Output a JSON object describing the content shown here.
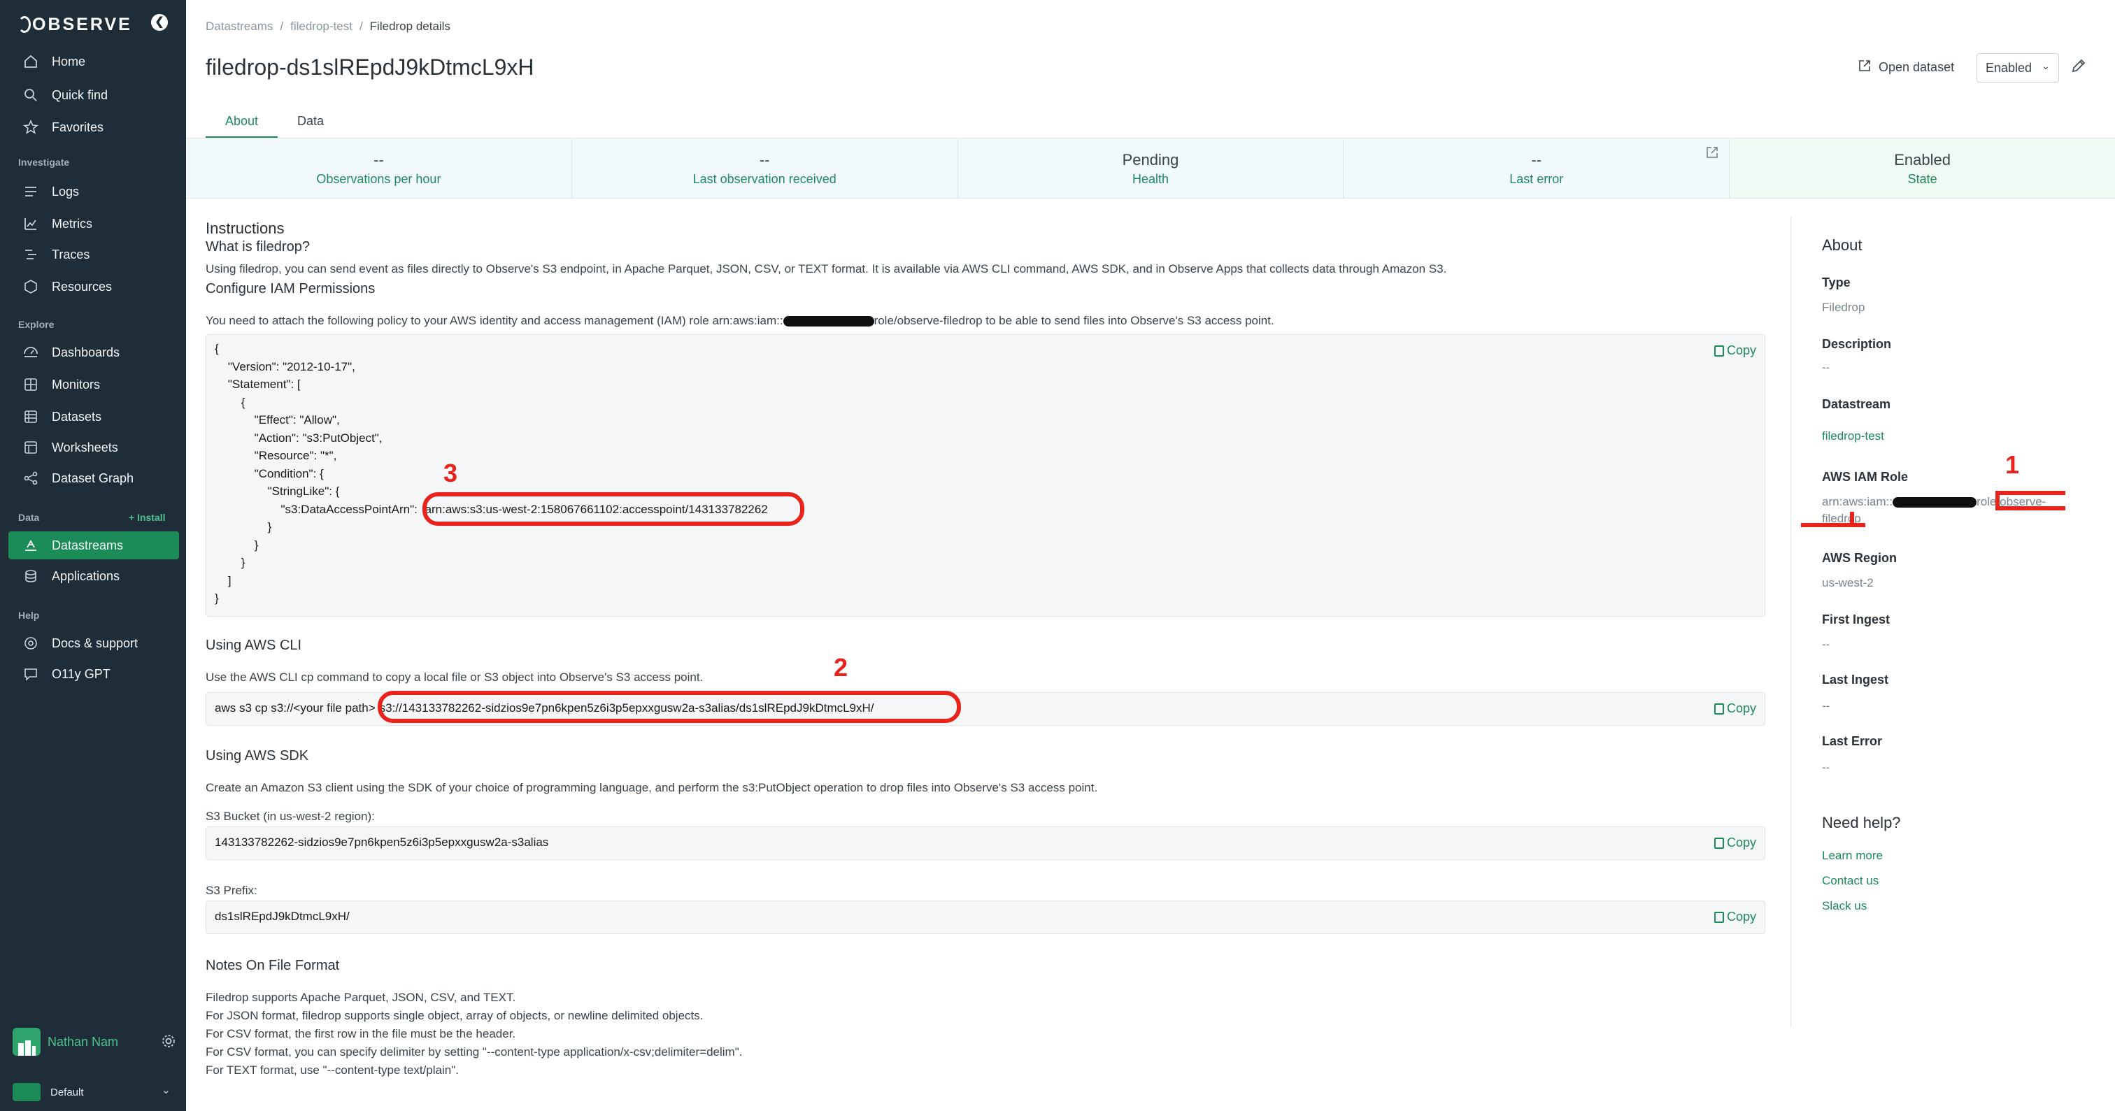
{
  "sidebar": {
    "logo": "OBSERVE",
    "collapse_glyph": "❮",
    "items": [
      {
        "label": "Home",
        "icon": "home-icon"
      },
      {
        "label": "Quick find",
        "icon": "search-icon"
      },
      {
        "label": "Favorites",
        "icon": "star-icon"
      },
      {
        "label": "Logs",
        "icon": "logs-icon"
      },
      {
        "label": "Metrics",
        "icon": "metrics-icon"
      },
      {
        "label": "Traces",
        "icon": "traces-icon"
      },
      {
        "label": "Resources",
        "icon": "resources-icon"
      },
      {
        "label": "Dashboards",
        "icon": "dashboard-icon"
      },
      {
        "label": "Monitors",
        "icon": "monitor-icon"
      },
      {
        "label": "Datasets",
        "icon": "dataset-icon"
      },
      {
        "label": "Worksheets",
        "icon": "worksheet-icon"
      },
      {
        "label": "Dataset Graph",
        "icon": "graph-icon"
      },
      {
        "label": "Datastreams",
        "icon": "datastream-icon"
      },
      {
        "label": "Applications",
        "icon": "applications-icon"
      },
      {
        "label": "Docs & support",
        "icon": "help-icon"
      },
      {
        "label": "O11y GPT",
        "icon": "chat-icon"
      }
    ],
    "sections": {
      "investigate": "Investigate",
      "explore": "Explore",
      "data": "Data",
      "help": "Help"
    },
    "install_label": "+ Install",
    "user_name": "Nathan Nam",
    "workspace": "Default",
    "active_color": "#1b8b57"
  },
  "header": {
    "breadcrumb": [
      "Datastreams",
      "filedrop-test",
      "Filedrop details"
    ],
    "title": "filedrop-ds1slREpdJ9kDtmcL9xH",
    "open_dataset": "Open dataset",
    "status_value": "Enabled"
  },
  "tabs": [
    {
      "label": "About"
    },
    {
      "label": "Data"
    }
  ],
  "stats": [
    {
      "value": "--",
      "label": "Observations per hour"
    },
    {
      "value": "--",
      "label": "Last observation received"
    },
    {
      "value": "Pending",
      "label": "Health"
    },
    {
      "value": "--",
      "label": "Last error"
    },
    {
      "value": "Enabled",
      "label": "State"
    }
  ],
  "instructions": {
    "title": "Instructions",
    "what_title": "What is filedrop?",
    "what_text": "Using filedrop, you can send event as files directly to Observe's S3 endpoint, in Apache Parquet, JSON, CSV, or TEXT format. It is available via AWS CLI command, AWS SDK, and in Observe Apps that collects data through Amazon S3.",
    "iam_title": "Configure IAM Permissions",
    "iam_text_pre": "You need to attach the following policy to your AWS identity and access management (IAM) role arn:aws:iam::",
    "iam_text_post": "role/observe-filedrop to be able to send files into Observe's S3 access point.",
    "policy_lines": [
      "{",
      "    \"Version\": \"2012-10-17\",",
      "    \"Statement\": [",
      "        {",
      "            \"Effect\": \"Allow\",",
      "            \"Action\": \"s3:PutObject\",",
      "            \"Resource\": \"*\",",
      "            \"Condition\": {",
      "                \"StringLike\": {",
      "                    \"s3:DataAccessPointArn\": ",
      "                }",
      "            }",
      "        }",
      "    ]",
      "}"
    ],
    "access_point_arn": "arn:aws:s3:us-west-2:158067661102:accesspoint/143133782262",
    "copy_label": "Copy",
    "cli_title": "Using AWS CLI",
    "cli_text": "Use the AWS CLI cp command to copy a local file or S3 object into Observe's S3 access point.",
    "cli_cmd_prefix": "aws s3 cp s3://<your file path>",
    "cli_cmd_target": "s3://143133782262-sidzios9e7pn6kpen5z6i3p5epxxgusw2a-s3alias/ds1slREpdJ9kDtmcL9xH/",
    "sdk_title": "Using AWS SDK",
    "sdk_text": "Create an Amazon S3 client using the SDK of your choice of programming language, and perform the s3:PutObject operation to drop files into Observe's S3 access point.",
    "bucket_label": "S3 Bucket (in us-west-2 region):",
    "bucket_value": "143133782262-sidzios9e7pn6kpen5z6i3p5epxxgusw2a-s3alias",
    "prefix_label": "S3 Prefix:",
    "prefix_value": "ds1slREpdJ9kDtmcL9xH/",
    "notes_title": "Notes On File Format",
    "notes": [
      "Filedrop supports Apache Parquet, JSON, CSV, and TEXT.",
      "For JSON format, filedrop supports single object, array of objects, or newline delimited objects.",
      "For CSV format, the first row in the file must be the header.",
      "For CSV format, you can specify delimiter by setting \"--content-type application/x-csv;delimiter=delim\".",
      "For TEXT format, use \"--content-type text/plain\"."
    ]
  },
  "about_panel": {
    "title": "About",
    "type_label": "Type",
    "type_value": "Filedrop",
    "description_label": "Description",
    "description_value": "--",
    "datastream_label": "Datastream",
    "datastream_value": "filedrop-test",
    "role_label": "AWS IAM Role",
    "role_prefix": "arn:aws:iam::",
    "role_mid": "role/",
    "role_suffix": "observe-",
    "role_line2": "filedrop",
    "region_label": "AWS Region",
    "region_value": "us-west-2",
    "first_ingest_label": "First Ingest",
    "first_ingest_value": "--",
    "last_ingest_label": "Last Ingest",
    "last_ingest_value": "--",
    "last_error_label": "Last Error",
    "last_error_value": "--",
    "help_title": "Need help?",
    "learn_more": "Learn more",
    "contact_us": "Contact us",
    "slack_us": "Slack us"
  },
  "annotations": {
    "one": "1",
    "two": "2",
    "three": "3",
    "color": "#e8231c"
  }
}
